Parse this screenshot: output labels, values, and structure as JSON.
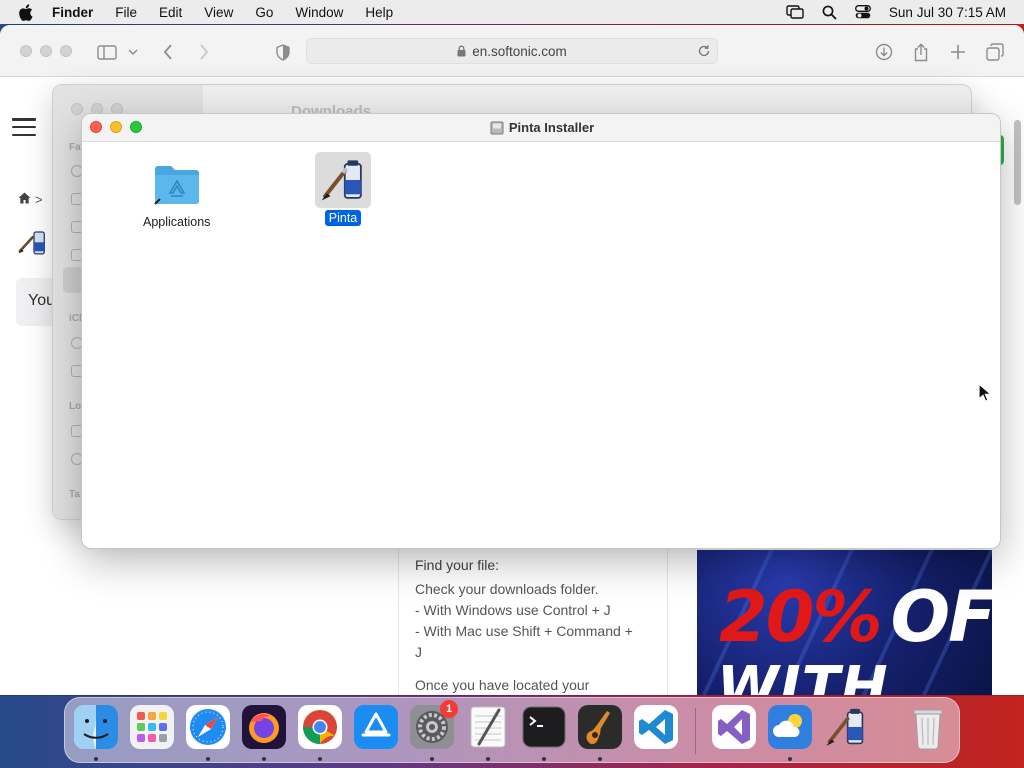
{
  "menubar": {
    "app_name": "Finder",
    "menus": [
      "File",
      "Edit",
      "View",
      "Go",
      "Window",
      "Help"
    ],
    "clock": "Sun Jul 30  7:15 AM"
  },
  "safari": {
    "url": "en.softonic.com",
    "web": {
      "card_text": "You",
      "find_title": "Find your file:",
      "find_lines": [
        "Check your downloads folder.",
        "- With Windows use Control + J",
        "- With Mac use Shift + Command +",
        "J"
      ],
      "find_more": "Once you have located your",
      "ad_percent": "20%",
      "ad_off": "OFF",
      "ad_code": "WITH CODE:"
    }
  },
  "finder_bg": {
    "title": "Downloads",
    "sidebar_labels": [
      "Fa",
      "iCl",
      "Lo",
      "Ta"
    ]
  },
  "installer": {
    "title": "Pinta Installer",
    "items": [
      {
        "label": "Applications",
        "icon": "applications-folder-icon",
        "selected": false
      },
      {
        "label": "Pinta",
        "icon": "pinta-app-icon",
        "selected": true
      }
    ]
  },
  "dock": {
    "apps": [
      "Finder",
      "Launchpad",
      "Safari",
      "Firefox",
      "Chrome",
      "App Store",
      "System Preferences",
      "TextEdit",
      "Terminal",
      "GarageBand",
      "Visual Studio Code",
      "Visual Studio",
      "Weather",
      "Pinta",
      "Trash"
    ],
    "system_prefs_badge": "1"
  }
}
